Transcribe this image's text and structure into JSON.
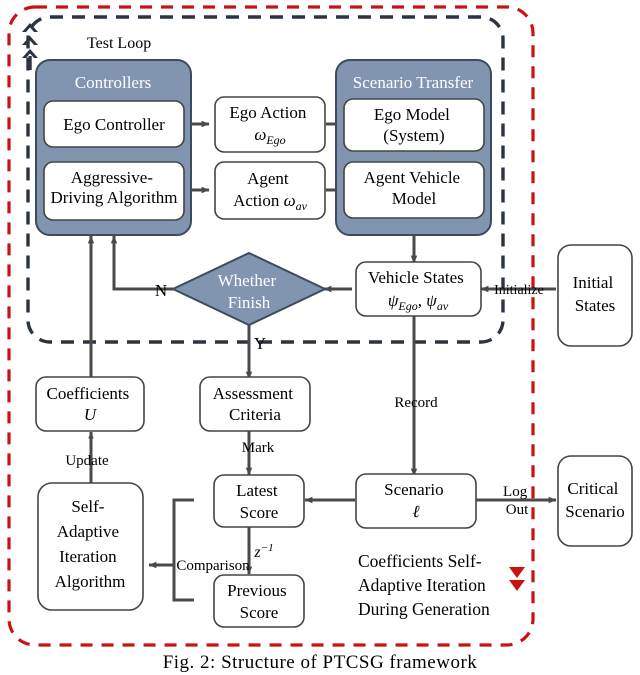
{
  "figure": {
    "caption": "Fig. 2: Structure of PTCSG framework",
    "colors": {
      "group_fill": "#8295b0",
      "group_stroke": "#3d4b5e",
      "box_fill": "#ffffff",
      "box_stroke": "#444444",
      "arrow": "#4a4a4a",
      "outer_dashed": "#cc1111",
      "inner_dashed": "#2b3440",
      "text": "#000000",
      "group_label_text": "#ffffff"
    }
  },
  "regions": {
    "test_loop_label": "Test Loop",
    "bottom_note": [
      "Coefficients Self-",
      "Adaptive Iteration",
      "During Generation"
    ]
  },
  "groups": {
    "controllers": {
      "title": "Controllers",
      "children": [
        {
          "lines": [
            "Ego Controller"
          ]
        },
        {
          "lines": [
            "Aggressive-",
            "Driving Algorithm"
          ]
        }
      ]
    },
    "scenario_transfer": {
      "title": "Scenario Transfer",
      "children": [
        {
          "lines": [
            "Ego Model",
            "(System)"
          ]
        },
        {
          "lines": [
            "Agent Vehicle",
            "Model"
          ]
        }
      ]
    }
  },
  "nodes": {
    "ego_action": {
      "lines": [
        "Ego Action",
        "ω<sub>Ego</sub>"
      ]
    },
    "agent_action": {
      "lines": [
        "Agent",
        "Action ω<sub>av</sub>"
      ]
    },
    "vehicle_states": {
      "lines": [
        "Vehicle States",
        "ψ<sub>Ego</sub>, ψ<sub>av</sub>"
      ]
    },
    "initial_states": {
      "lines": [
        "Initial",
        "States"
      ]
    },
    "whether_finish": {
      "lines": [
        "Whether",
        "Finish"
      ]
    },
    "coefficients": {
      "lines": [
        "Coefficients",
        "U"
      ]
    },
    "assessment": {
      "lines": [
        "Assessment",
        "Criteria"
      ]
    },
    "self_adaptive": {
      "lines": [
        "Self-",
        "Adaptive",
        "Iteration",
        "Algorithm"
      ]
    },
    "latest_score": {
      "lines": [
        "Latest",
        "Score"
      ]
    },
    "previous_score": {
      "lines": [
        "Previous",
        "Score"
      ]
    },
    "scenario": {
      "lines": [
        "Scenario",
        "ℓ"
      ]
    },
    "critical": {
      "lines": [
        "Critical",
        "Scenario"
      ]
    }
  },
  "edge_labels": {
    "n_branch": "N",
    "y_branch": "Y",
    "initialize": "Initialize",
    "record": "Record",
    "mark": "Mark",
    "update": "Update",
    "comparison": "Comparison",
    "z_inverse": "z⁻¹",
    "log_out": [
      "Log",
      "Out"
    ]
  },
  "icons": {
    "top_chevron": "double-chevron-up-icon",
    "bottom_chevron": "double-chevron-down-icon"
  }
}
